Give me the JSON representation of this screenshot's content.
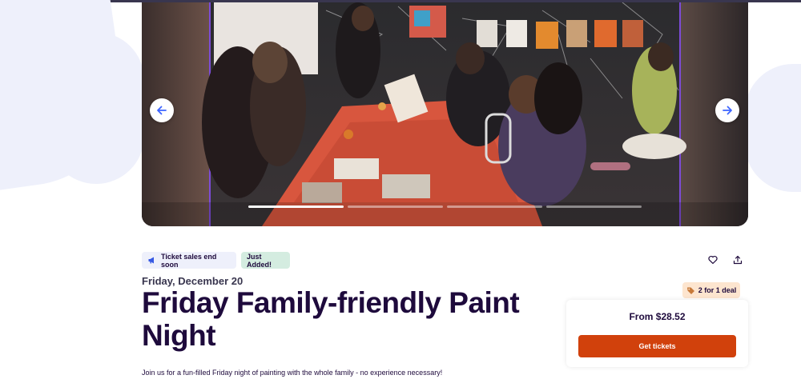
{
  "gallery": {
    "prev_icon": "arrow-left-icon",
    "next_icon": "arrow-right-icon",
    "slide_count": 4,
    "active_slide": 1,
    "accent_color": "#3d64ff"
  },
  "badges": {
    "sales": "Ticket sales end soon",
    "sales_icon": "megaphone-icon",
    "added": "Just Added!"
  },
  "event": {
    "date": "Friday, December 20",
    "title": "Friday Family-friendly Paint Night",
    "summary": "Join us for a fun-filled Friday night of painting with the whole family - no experience necessary!"
  },
  "actions": {
    "like_icon": "heart-icon",
    "share_icon": "share-icon"
  },
  "deal": {
    "label": "2 for 1 deal",
    "icon": "tag-icon"
  },
  "tickets": {
    "price": "From $28.52",
    "button": "Get tickets",
    "button_color": "#d1410c"
  }
}
